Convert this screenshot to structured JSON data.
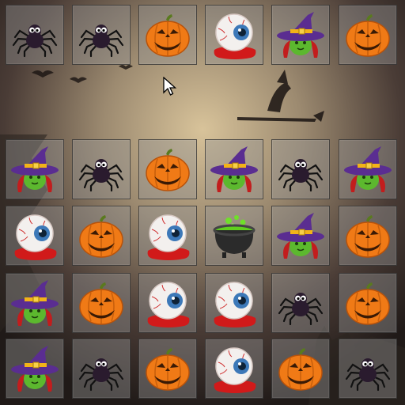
{
  "game": {
    "board": [
      [
        "spider",
        "spider",
        "pumpkin",
        "eyeball",
        "witch",
        "pumpkin"
      ],
      [
        "witch",
        "spider",
        "pumpkin",
        "witch",
        "spider",
        "witch"
      ],
      [
        "eyeball",
        "pumpkin",
        "eyeball",
        "cauldron",
        "witch",
        "pumpkin"
      ],
      [
        "witch",
        "pumpkin",
        "eyeball",
        "eyeball",
        "spider",
        "pumpkin"
      ],
      [
        "witch",
        "spider",
        "pumpkin",
        "eyeball",
        "pumpkin",
        "spider"
      ]
    ],
    "empty_row_after": 0
  },
  "icons": {
    "spider": "spider-icon",
    "pumpkin": "pumpkin-icon",
    "eyeball": "eyeball-icon",
    "witch": "witch-hat-icon",
    "cauldron": "cauldron-icon"
  },
  "colors": {
    "background_dark": "#2a2320",
    "moon_glow": "#c9b48a",
    "pumpkin": "#f07a16",
    "witch_hat": "#5a2d91",
    "witch_face": "#5cb82e",
    "eye_iris": "#3c78b8",
    "blood": "#d11a1a",
    "tile_border": "#2a2a2a"
  }
}
